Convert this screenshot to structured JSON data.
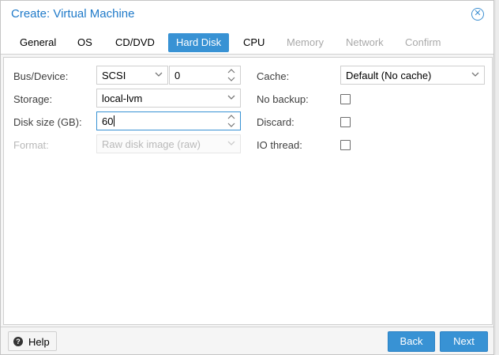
{
  "window": {
    "title": "Create: Virtual Machine"
  },
  "tabs": [
    {
      "label": "General",
      "state": "enabled"
    },
    {
      "label": "OS",
      "state": "enabled"
    },
    {
      "label": "CD/DVD",
      "state": "enabled"
    },
    {
      "label": "Hard Disk",
      "state": "active"
    },
    {
      "label": "CPU",
      "state": "enabled"
    },
    {
      "label": "Memory",
      "state": "disabled"
    },
    {
      "label": "Network",
      "state": "disabled"
    },
    {
      "label": "Confirm",
      "state": "disabled"
    }
  ],
  "form": {
    "bus_device": {
      "label": "Bus/Device:",
      "bus_value": "SCSI",
      "device_value": "0"
    },
    "storage": {
      "label": "Storage:",
      "value": "local-lvm"
    },
    "disk_size": {
      "label": "Disk size (GB):",
      "value": "60"
    },
    "format": {
      "label": "Format:",
      "value": "Raw disk image (raw)",
      "disabled": true
    },
    "cache": {
      "label": "Cache:",
      "value": "Default (No cache)"
    },
    "no_backup": {
      "label": "No backup:",
      "checked": false
    },
    "discard": {
      "label": "Discard:",
      "checked": false
    },
    "io_thread": {
      "label": "IO thread:",
      "checked": false
    }
  },
  "footer": {
    "help_label": "Help",
    "back_label": "Back",
    "next_label": "Next"
  },
  "colors": {
    "accent": "#3892d4",
    "title": "#1f7ac9"
  }
}
